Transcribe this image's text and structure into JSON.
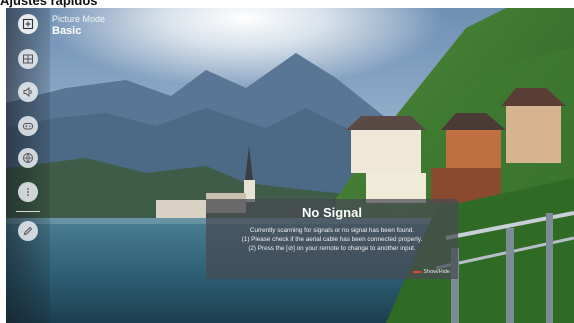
{
  "page": {
    "title": "Ajustes rápidos"
  },
  "sidebar": {
    "items": [
      {
        "icon": "picture-mode-icon"
      },
      {
        "icon": "aspect-grid-icon"
      },
      {
        "icon": "sound-icon"
      },
      {
        "icon": "gamepad-icon"
      },
      {
        "icon": "globe-network-icon"
      },
      {
        "icon": "more-dots-icon"
      },
      {
        "icon": "edit-pencil-icon"
      }
    ],
    "picture_mode_label": "Picture Mode",
    "picture_mode_value": "Basic"
  },
  "dialog": {
    "title": "No Signal",
    "lines": [
      "Currently scanning for signals or no signal has been found.",
      "(1) Please check if the aerial cable has been connected properly.",
      "(2) Press the [⊘] on your remote to change to another input."
    ],
    "hint": "Show/Hide"
  },
  "colors": {
    "hint_key": "#e0463a"
  }
}
